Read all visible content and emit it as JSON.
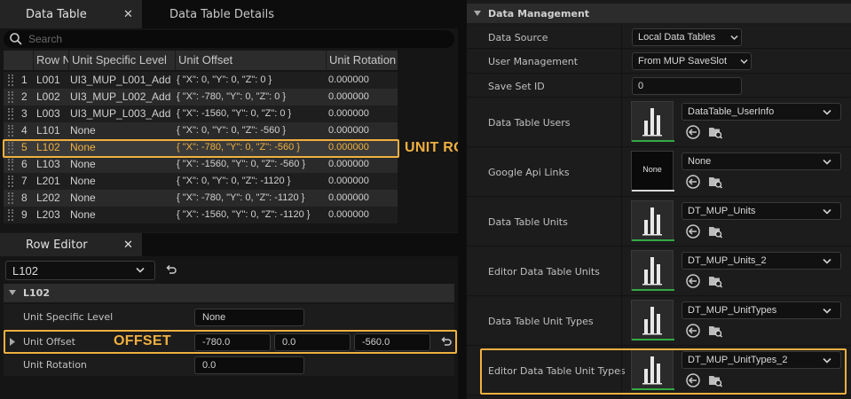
{
  "data_table_panel": {
    "tabs": [
      {
        "label": "Data Table",
        "close": "✕"
      },
      {
        "label": "Data Table Details"
      }
    ],
    "search_placeholder": "Search",
    "columns": [
      "Row N",
      "Unit Specific Level",
      "Unit Offset",
      "Unit Rotation"
    ],
    "rows": [
      {
        "index": "1",
        "name": "L001",
        "level": "UI3_MUP_L001_Add",
        "offset": "{ \"X\": 0, \"Y\": 0, \"Z\": 0 }",
        "rotation": "0.000000"
      },
      {
        "index": "2",
        "name": "L002",
        "level": "UI3_MUP_L002_Add",
        "offset": "{ \"X\": -780, \"Y\": 0, \"Z\": 0 }",
        "rotation": "0.000000"
      },
      {
        "index": "3",
        "name": "L003",
        "level": "UI3_MUP_L003_Add",
        "offset": "{ \"X\": -1560, \"Y\": 0, \"Z\": 0 }",
        "rotation": "0.000000"
      },
      {
        "index": "4",
        "name": "L101",
        "level": "None",
        "offset": "{ \"X\": 0, \"Y\": 0, \"Z\": -560 }",
        "rotation": "0.000000"
      },
      {
        "index": "5",
        "name": "L102",
        "level": "None",
        "offset": "{ \"X\": -780, \"Y\": 0, \"Z\": -560 }",
        "rotation": "0.000000"
      },
      {
        "index": "6",
        "name": "L103",
        "level": "None",
        "offset": "{ \"X\": -1560, \"Y\": 0, \"Z\": -560 }",
        "rotation": "0.000000"
      },
      {
        "index": "7",
        "name": "L201",
        "level": "None",
        "offset": "{ \"X\": 0, \"Y\": 0, \"Z\": -1120 }",
        "rotation": "0.000000"
      },
      {
        "index": "8",
        "name": "L202",
        "level": "None",
        "offset": "{ \"X\": -780, \"Y\": 0, \"Z\": -1120 }",
        "rotation": "0.000000"
      },
      {
        "index": "9",
        "name": "L203",
        "level": "None",
        "offset": "{ \"X\": -1560, \"Y\": 0, \"Z\": -1120 }",
        "rotation": "0.000000"
      }
    ],
    "selected_row": "5",
    "callout": "UNIT ROW"
  },
  "row_editor": {
    "tab_label": "Row Editor",
    "tab_close": "✕",
    "row_select": "L102",
    "section_title": "L102",
    "unit_specific_level": {
      "label": "Unit Specific Level",
      "value": "None"
    },
    "unit_offset": {
      "label": "Unit Offset",
      "x": "-780.0",
      "y": "0.0",
      "z": "-560.0"
    },
    "unit_rotation": {
      "label": "Unit Rotation",
      "value": "0.0"
    },
    "callout": "OFFSET"
  },
  "data_management": {
    "title": "Data Management",
    "data_source": {
      "label": "Data Source",
      "value": "Local Data Tables"
    },
    "user_management": {
      "label": "User Management",
      "value": "From MUP SaveSlot"
    },
    "save_set_id": {
      "label": "Save Set ID",
      "value": "0"
    },
    "assets": [
      {
        "label": "Data Table Users",
        "value": "DataTable_UserInfo",
        "thumb": "chart"
      },
      {
        "label": "Google Api Links",
        "value": "None",
        "thumb": "none",
        "thumb_text": "None"
      },
      {
        "label": "Data Table Units",
        "value": "DT_MUP_Units",
        "thumb": "chart"
      },
      {
        "label": "Editor Data Table Units",
        "value": "DT_MUP_Units_2",
        "thumb": "chart"
      },
      {
        "label": "Data Table Unit Types",
        "value": "DT_MUP_UnitTypes",
        "thumb": "chart"
      },
      {
        "label": "Editor Data Table Unit Types",
        "value": "DT_MUP_UnitTypes_2",
        "thumb": "chart"
      }
    ]
  },
  "colors": {
    "accent": "#f0b040",
    "panel": "#151515",
    "header": "#2c2c2c",
    "asset_bar": "#33aa44"
  }
}
